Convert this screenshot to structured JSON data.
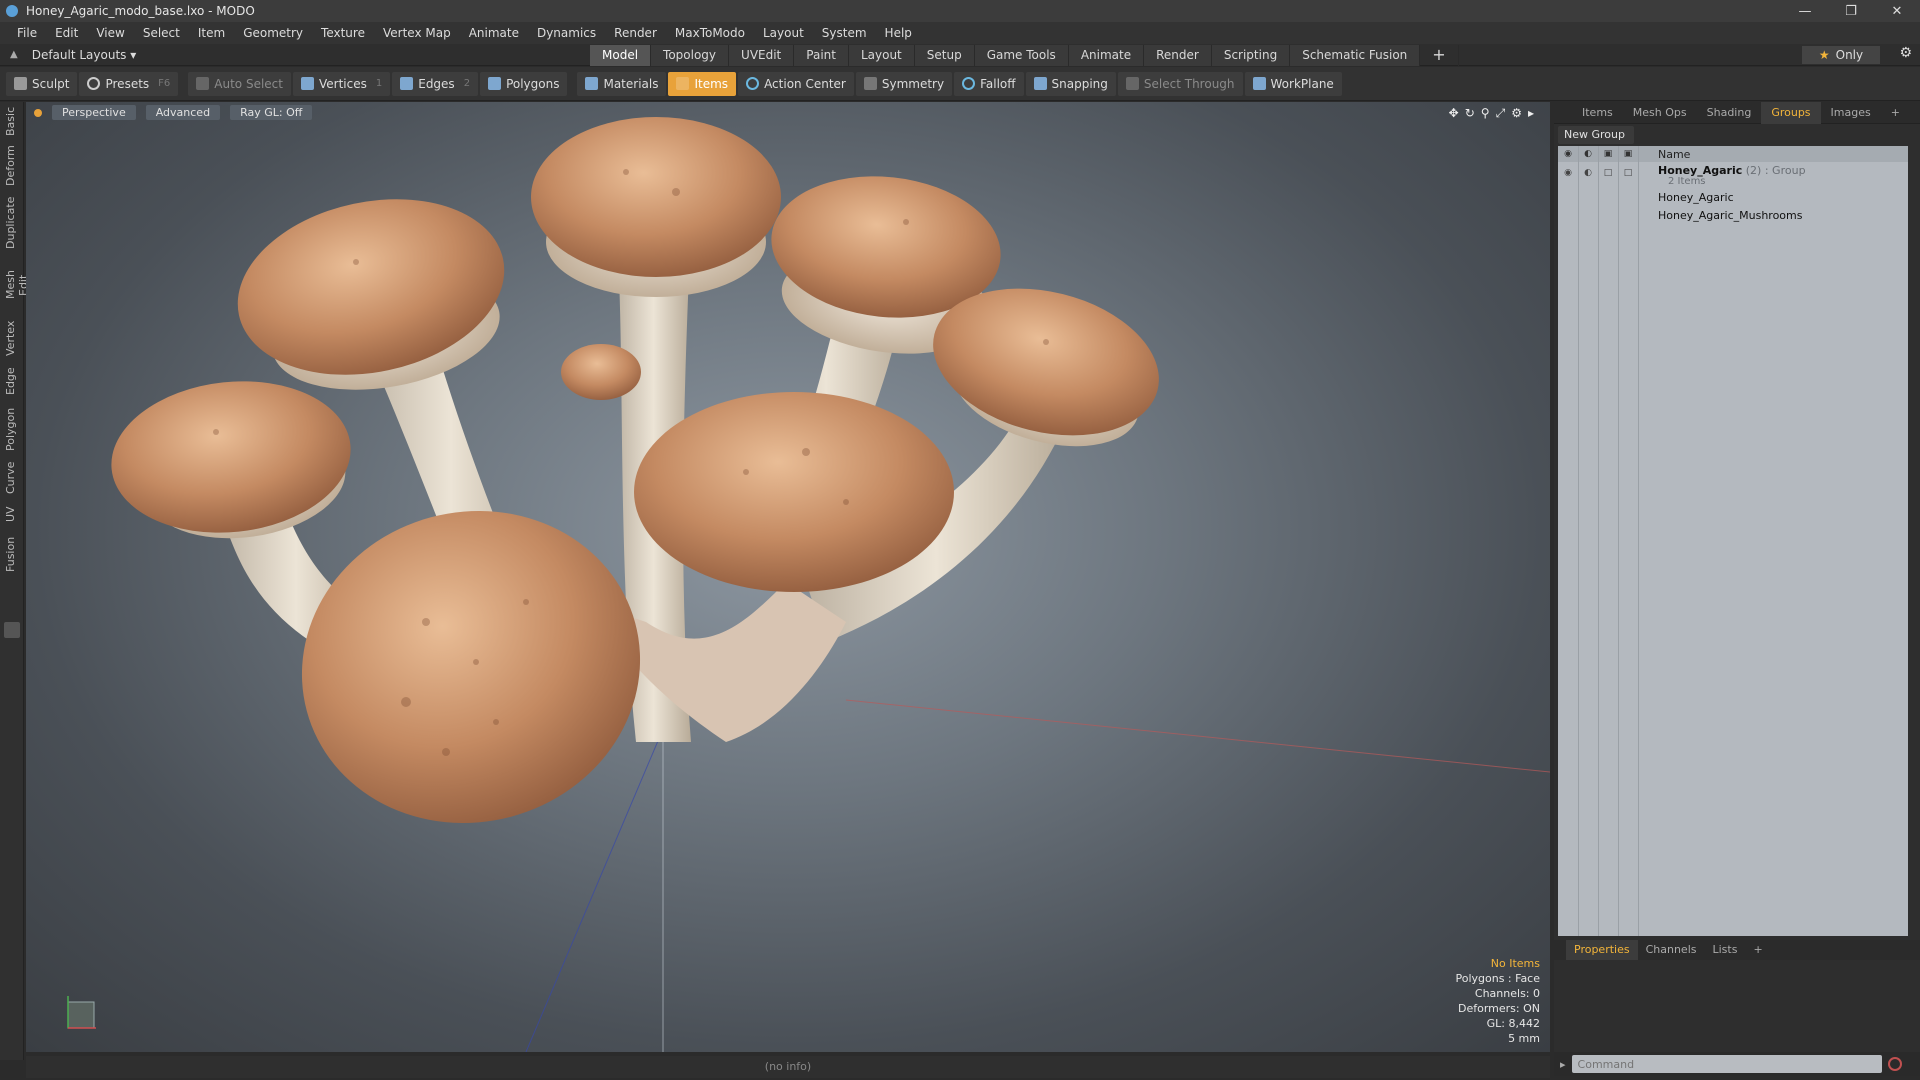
{
  "window": {
    "title": "Honey_Agaric_modo_base.lxo - MODO"
  },
  "menu": [
    "File",
    "Edit",
    "View",
    "Select",
    "Item",
    "Geometry",
    "Texture",
    "Vertex Map",
    "Animate",
    "Dynamics",
    "Render",
    "MaxToModo",
    "Layout",
    "System",
    "Help"
  ],
  "layout": {
    "dropdown": "Default Layouts ▾",
    "only": "Only"
  },
  "tabs": [
    "Model",
    "Topology",
    "UVEdit",
    "Paint",
    "Layout",
    "Setup",
    "Game Tools",
    "Animate",
    "Render",
    "Scripting",
    "Schematic Fusion"
  ],
  "toolbar": {
    "sculpt": "Sculpt",
    "presets": "Presets",
    "presets_key": "F6",
    "auto_select": "Auto Select",
    "vertices": "Vertices",
    "vertices_key": "1",
    "edges": "Edges",
    "edges_key": "2",
    "polygons": "Polygons",
    "materials": "Materials",
    "items": "Items",
    "action_center": "Action Center",
    "symmetry": "Symmetry",
    "falloff": "Falloff",
    "snapping": "Snapping",
    "select_through": "Select Through",
    "workplane": "WorkPlane"
  },
  "left_tabs": [
    "Basic",
    "Deform",
    "Duplicate",
    "Mesh Edit",
    "Vertex",
    "Edge",
    "Polygon",
    "Curve",
    "UV",
    "Fusion"
  ],
  "viewport": {
    "view": "Perspective",
    "shading": "Advanced",
    "raygl": "Ray GL: Off",
    "info": {
      "selection": "No Items",
      "polygons": "Polygons : Face",
      "channels": "Channels: 0",
      "deformers": "Deformers: ON",
      "gl": "GL: 8,442",
      "units": "5 mm"
    }
  },
  "right_panel": {
    "tabs": [
      "Items",
      "Mesh Ops",
      "Shading",
      "Groups",
      "Images"
    ],
    "new_group": "New Group",
    "column_name": "Name",
    "group": {
      "name": "Honey_Agaric",
      "count": "(2)",
      "type": ": Group",
      "items_label": "2 Items"
    },
    "children": [
      "Honey_Agaric",
      "Honey_Agaric_Mushrooms"
    ],
    "bottom_tabs": [
      "Properties",
      "Channels",
      "Lists"
    ],
    "command_placeholder": "Command"
  },
  "status": "(no info)",
  "colors": {
    "accent": "#e8a23a",
    "highlight": "#f3b53a"
  }
}
